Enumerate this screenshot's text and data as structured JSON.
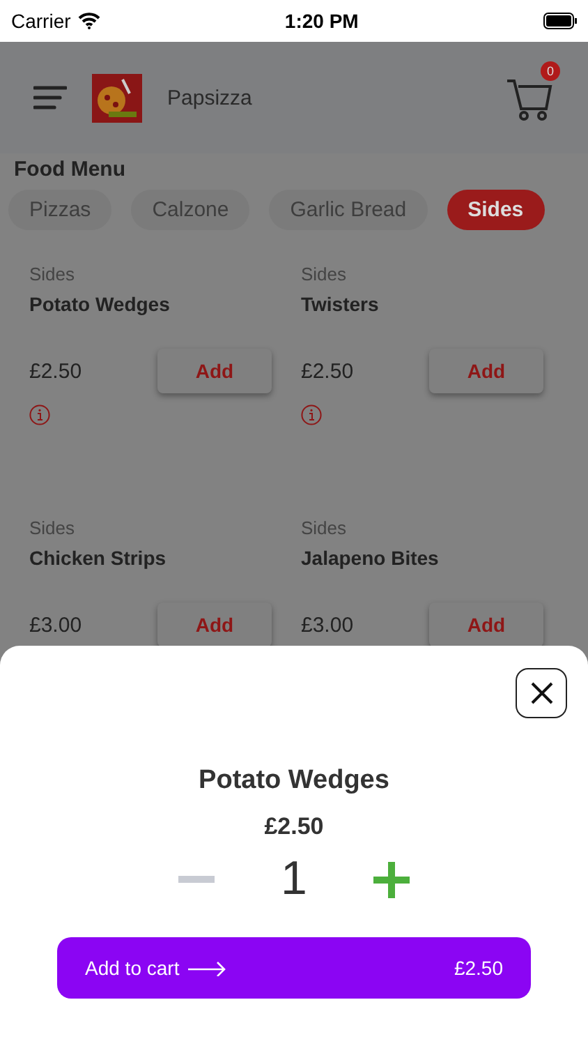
{
  "status_bar": {
    "carrier": "Carrier",
    "time": "1:20 PM"
  },
  "header": {
    "title": "Papsizza",
    "cart_count": "0"
  },
  "section_title": "Food Menu",
  "tabs": [
    {
      "label": "Pizzas",
      "selected": false
    },
    {
      "label": "Calzone",
      "selected": false
    },
    {
      "label": "Garlic Bread",
      "selected": false
    },
    {
      "label": "Sides",
      "selected": true
    }
  ],
  "items": [
    {
      "category": "Sides",
      "name": "Potato Wedges",
      "price": "£2.50",
      "button": "Add",
      "info": true
    },
    {
      "category": "Sides",
      "name": "Twisters",
      "price": "£2.50",
      "button": "Add",
      "info": true
    },
    {
      "category": "Sides",
      "name": "Chicken Strips",
      "price": "£3.00",
      "button": "Add"
    },
    {
      "category": "Sides",
      "name": "Jalapeno Bites",
      "price": "£3.00",
      "button": "Add"
    }
  ],
  "sheet": {
    "name": "Potato Wedges",
    "price": "£2.50",
    "quantity": "1",
    "add_label": "Add to cart",
    "add_price": "£2.50"
  }
}
